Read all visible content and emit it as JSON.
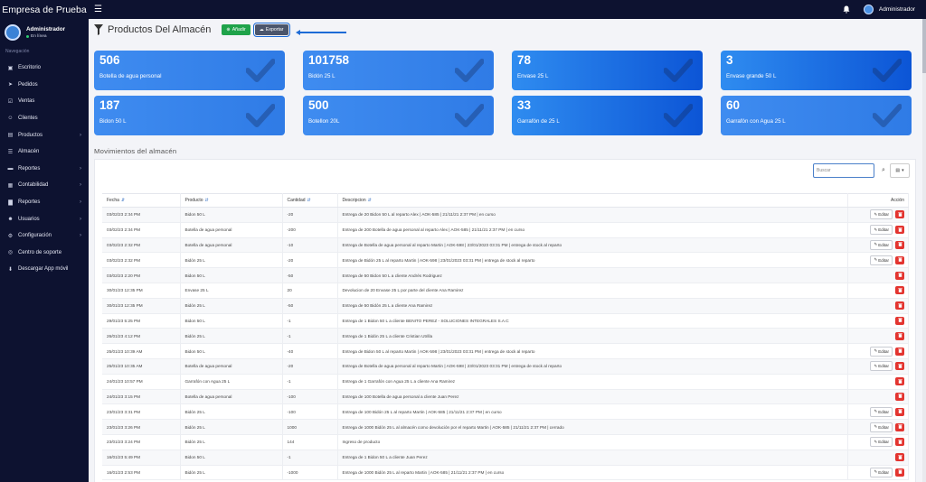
{
  "app": {
    "brand": "Empresa de Prueba",
    "user": "Administrador"
  },
  "sidebar": {
    "user_name": "Administrador",
    "status": "En línea",
    "nav_label": "Navegación",
    "items": [
      {
        "label": "Escritorio",
        "icon": "dashboard-icon",
        "chevron": false
      },
      {
        "label": "Pedidos",
        "icon": "plane-icon",
        "chevron": false
      },
      {
        "label": "Ventas",
        "icon": "check-square-icon",
        "chevron": false
      },
      {
        "label": "Clientes",
        "icon": "users-icon",
        "chevron": false
      },
      {
        "label": "Productos",
        "icon": "box-icon",
        "chevron": true
      },
      {
        "label": "Almacén",
        "icon": "list-icon",
        "chevron": false
      },
      {
        "label": "Reportes",
        "icon": "truck-icon",
        "chevron": true
      },
      {
        "label": "Contabilidad",
        "icon": "calculator-icon",
        "chevron": true
      },
      {
        "label": "Reportes",
        "icon": "bar-chart-icon",
        "chevron": true
      },
      {
        "label": "Usuarios",
        "icon": "user-icon",
        "chevron": true
      },
      {
        "label": "Configuración",
        "icon": "gear-icon",
        "chevron": true
      },
      {
        "label": "Centro de soporte",
        "icon": "support-icon",
        "chevron": false
      },
      {
        "label": "Descargar App móvil",
        "icon": "download-icon",
        "chevron": false
      }
    ]
  },
  "header": {
    "title": "Productos Del Almacén",
    "add_label": "Añadir",
    "export_label": "Exportar"
  },
  "cards": [
    {
      "value": "506",
      "label": "Botella de agua personal",
      "dark": false
    },
    {
      "value": "101758",
      "label": "Bidón 25 L",
      "dark": false
    },
    {
      "value": "78",
      "label": "Envase 25 L",
      "dark": true
    },
    {
      "value": "3",
      "label": "Envase grande 50 L",
      "dark": true
    },
    {
      "value": "187",
      "label": "Bidon 50 L",
      "dark": false
    },
    {
      "value": "500",
      "label": "Botellon 20L",
      "dark": false
    },
    {
      "value": "33",
      "label": "Garrafón de 25 L",
      "dark": true
    },
    {
      "value": "60",
      "label": "Garrafón con Agua 25 L",
      "dark": false
    }
  ],
  "section_title": "Movimientos del almacén",
  "search": {
    "placeholder": "Buscar"
  },
  "columns": {
    "fecha": "Fecha",
    "producto": "Producto",
    "cantidad": "Cantidad",
    "descripcion": "Descripcion",
    "accion": "Acción"
  },
  "edit_label": "Editar",
  "colors": {
    "sidebar": "#0d1230",
    "card": "#3f8cf0",
    "add": "#1fa34a",
    "delete": "#e3342f"
  },
  "rows": [
    {
      "fecha": "03/02/23 2:34 PM",
      "producto": "Bidon 50 L",
      "cantidad": "-20",
      "descripcion": "Entrega de 20 Bidon 50 L al reparto Alex | AOK-585 | 21/11/21 2:37 PM | en curso",
      "edit": true
    },
    {
      "fecha": "03/02/23 2:34 PM",
      "producto": "Botella de agua personal",
      "cantidad": "-200",
      "descripcion": "Entrega de 200 Botella de agua personal al reparto Alex | AOK-585 | 21/11/21 2:37 PM | en curso",
      "edit": true
    },
    {
      "fecha": "03/02/23 2:32 PM",
      "producto": "Botella de agua personal",
      "cantidad": "-10",
      "descripcion": "Entrega de Botella de agua personal al reparto Martin | AOK-598 | 23/01/2023 03:31 PM | entrega de stock al reparto",
      "edit": true
    },
    {
      "fecha": "03/02/23 2:32 PM",
      "producto": "Bidón 25 L",
      "cantidad": "-20",
      "descripcion": "Entrega de Bidón 25 L al reparto Martin | AOK-598 | 23/01/2023 03:31 PM | entrega de stock al reparto",
      "edit": true
    },
    {
      "fecha": "03/02/23 2:20 PM",
      "producto": "Bidon 50 L",
      "cantidad": "-50",
      "descripcion": "Entrega de 50 Bidon 50 L a cliente Andrés Rodriguez",
      "edit": false
    },
    {
      "fecha": "30/01/23 12:35 PM",
      "producto": "Envase 25 L",
      "cantidad": "20",
      "descripcion": "Devolucion de 20 Envase 25 L por parte del cliente Ana Ramirez",
      "edit": false
    },
    {
      "fecha": "30/01/23 12:35 PM",
      "producto": "Bidón 25 L",
      "cantidad": "-50",
      "descripcion": "Entrega de 50 Bidón 25 L a cliente Ana Ramirez",
      "edit": false
    },
    {
      "fecha": "29/01/23 5:25 PM",
      "producto": "Bidon 50 L",
      "cantidad": "-1",
      "descripcion": "Entrega de 1 Bidon 50 L a cliente BENITO PEREZ - SOLUCIONES INTEGRALES S.A.C",
      "edit": false
    },
    {
      "fecha": "26/01/23 4:12 PM",
      "producto": "Bidón 25 L",
      "cantidad": "-1",
      "descripcion": "Entrega de 1 Bidón 25 L a cliente Cristian Utrilla",
      "edit": false
    },
    {
      "fecha": "25/01/23 10:39 AM",
      "producto": "Bidon 50 L",
      "cantidad": "-40",
      "descripcion": "Entrega de Bidon 50 L al reparto Martin | AOK-598 | 23/01/2023 03:31 PM | entrega de stock al reparto",
      "edit": true
    },
    {
      "fecha": "25/01/23 10:35 AM",
      "producto": "Botella de agua personal",
      "cantidad": "-20",
      "descripcion": "Entrega de Botella de agua personal al reparto Martin | AOK-598 | 23/01/2023 03:31 PM | entrega de stock al reparto",
      "edit": true
    },
    {
      "fecha": "24/01/23 10:57 PM",
      "producto": "Garrafón con Agua 25 L",
      "cantidad": "-1",
      "descripcion": "Entrega de 1 Garrafón con Agua 25 L a cliente Ana Ramirez",
      "edit": false
    },
    {
      "fecha": "24/01/23 3:15 PM",
      "producto": "Botella de agua personal",
      "cantidad": "-100",
      "descripcion": "Entrega de 100 Botella de agua personal a cliente Juan Perez",
      "edit": false
    },
    {
      "fecha": "23/01/23 3:31 PM",
      "producto": "Bidón 25 L",
      "cantidad": "-100",
      "descripcion": "Entrega de 100 Bidón 25 L al reparto Martin | AOK-585 | 21/11/21 2:37 PM | en curso",
      "edit": true
    },
    {
      "fecha": "23/01/23 3:26 PM",
      "producto": "Bidón 25 L",
      "cantidad": "1000",
      "descripcion": "Entrega de 1000 Bidón 25 L al almacén como devolución por el reparto Martin | AOK-585 | 21/11/21 2:37 PM | cerrado",
      "edit": true
    },
    {
      "fecha": "23/01/23 3:24 PM",
      "producto": "Bidón 25 L",
      "cantidad": "144",
      "descripcion": "Ingreso de producto",
      "edit": true
    },
    {
      "fecha": "16/01/23 5:49 PM",
      "producto": "Bidon 50 L",
      "cantidad": "-1",
      "descripcion": "Entrega de 1 Bidon 50 L a cliente Juan Perez",
      "edit": false
    },
    {
      "fecha": "16/01/23 2:53 PM",
      "producto": "Bidón 25 L",
      "cantidad": "-1000",
      "descripcion": "Entrega de 1000 Bidón 25 L al reparto Martin | AOK-585 | 21/11/21 2:37 PM | en curso",
      "edit": true
    }
  ]
}
